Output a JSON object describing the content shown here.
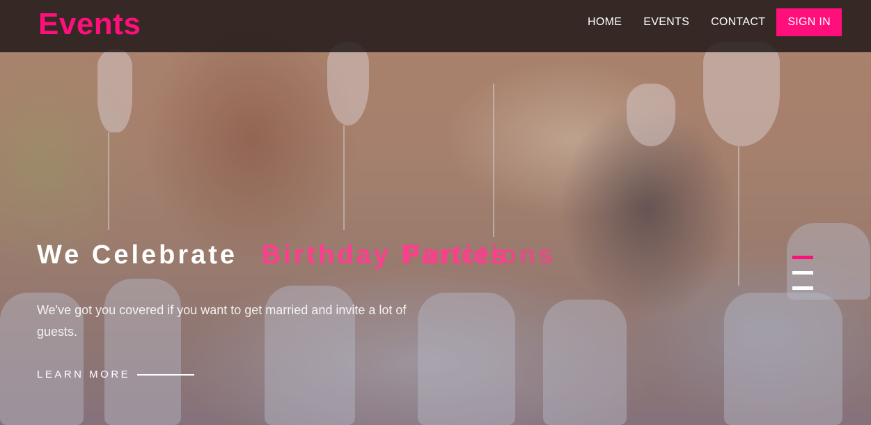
{
  "header": {
    "brand": "Events",
    "nav": [
      "HOME",
      "EVENTS",
      "CONTACT"
    ],
    "signin_label": "SIGN IN"
  },
  "hero": {
    "headline_static": "We Celebrate",
    "headline_rotating": "Birthday Parties",
    "headline_rotating_ghost": "Functions",
    "description": "We've got you covered if you want to get married and invite a lot of guests.",
    "learn_more": "LEARN MORE",
    "slides": 3,
    "active_slide": 1
  },
  "colors": {
    "accent": "#ff0f7b",
    "header_bg": "#1c1616",
    "text": "#ffffff"
  }
}
